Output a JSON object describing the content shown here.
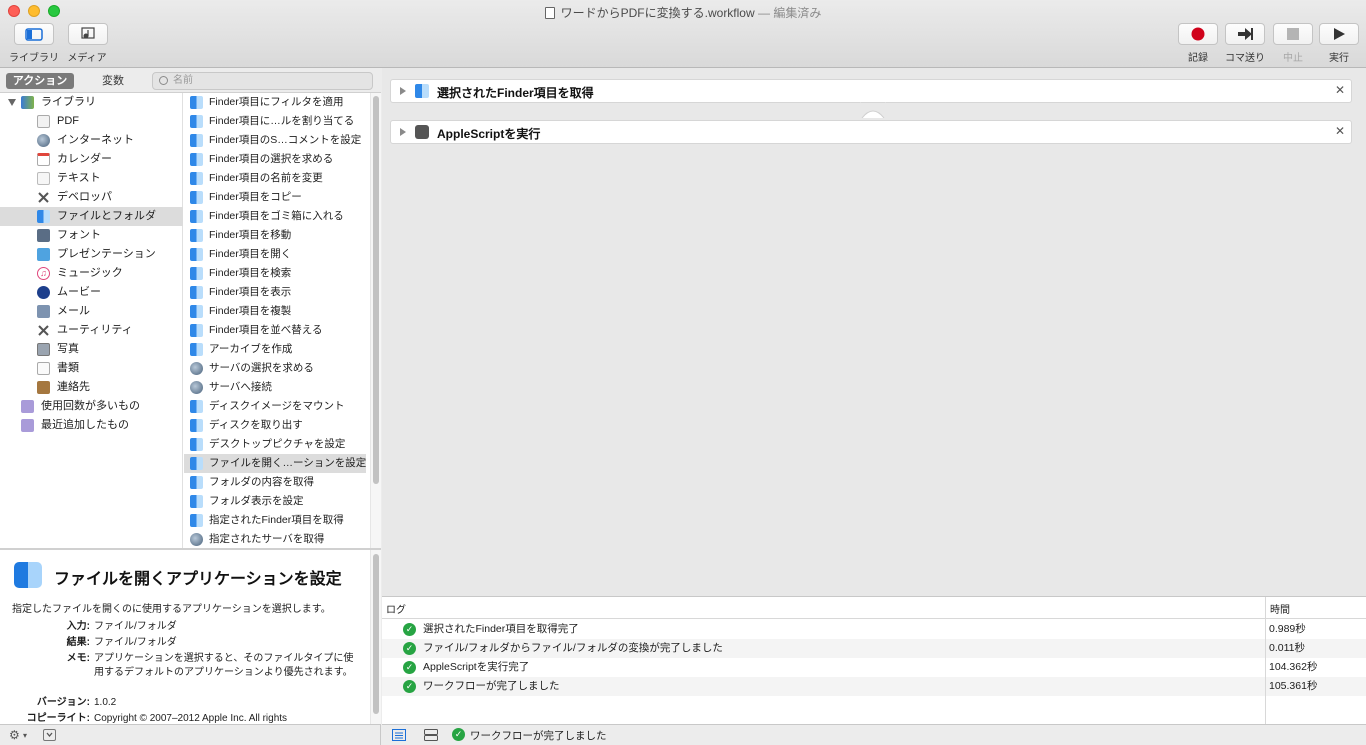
{
  "window": {
    "title": "ワードからPDFに変換する.workflow",
    "edited": "— 編集済み"
  },
  "toolbar": {
    "library_label": "ライブラリ",
    "media_label": "メディア",
    "record_label": "記録",
    "step_label": "コマ送り",
    "stop_label": "中止",
    "run_label": "実行",
    "record_color": "#d0021b"
  },
  "left_header": {
    "actions_tab": "アクション",
    "variables_tab": "変数",
    "search_placeholder": "名前"
  },
  "library": {
    "root": "ライブラリ",
    "items": [
      {
        "label": "PDF",
        "icon": "pdf-icon"
      },
      {
        "label": "インターネット",
        "icon": "globe-icon"
      },
      {
        "label": "カレンダー",
        "icon": "calendar-icon"
      },
      {
        "label": "テキスト",
        "icon": "text-icon"
      },
      {
        "label": "デベロッパ",
        "icon": "tools-icon"
      },
      {
        "label": "ファイルとフォルダ",
        "icon": "finder-icon"
      },
      {
        "label": "フォント",
        "icon": "font-icon"
      },
      {
        "label": "プレゼンテーション",
        "icon": "presentation-icon"
      },
      {
        "label": "ミュージック",
        "icon": "music-icon"
      },
      {
        "label": "ムービー",
        "icon": "movie-icon"
      },
      {
        "label": "メール",
        "icon": "mail-icon"
      },
      {
        "label": "ユーティリティ",
        "icon": "utility-icon"
      },
      {
        "label": "写真",
        "icon": "photo-icon"
      },
      {
        "label": "書類",
        "icon": "document-icon"
      },
      {
        "label": "連絡先",
        "icon": "contacts-icon"
      }
    ],
    "smart_groups": [
      "使用回数が多いもの",
      "最近追加したもの"
    ]
  },
  "actions": [
    {
      "label": "Finder項目にフィルタを適用",
      "icon": "finder"
    },
    {
      "label": "Finder項目に…ルを割り当てる",
      "icon": "finder"
    },
    {
      "label": "Finder項目のS…コメントを設定",
      "icon": "finder"
    },
    {
      "label": "Finder項目の選択を求める",
      "icon": "finder"
    },
    {
      "label": "Finder項目の名前を変更",
      "icon": "finder"
    },
    {
      "label": "Finder項目をコピー",
      "icon": "finder"
    },
    {
      "label": "Finder項目をゴミ箱に入れる",
      "icon": "finder"
    },
    {
      "label": "Finder項目を移動",
      "icon": "finder"
    },
    {
      "label": "Finder項目を開く",
      "icon": "finder"
    },
    {
      "label": "Finder項目を検索",
      "icon": "finder"
    },
    {
      "label": "Finder項目を表示",
      "icon": "finder"
    },
    {
      "label": "Finder項目を複製",
      "icon": "finder"
    },
    {
      "label": "Finder項目を並べ替える",
      "icon": "finder"
    },
    {
      "label": "アーカイブを作成",
      "icon": "finder"
    },
    {
      "label": "サーバの選択を求める",
      "icon": "globe"
    },
    {
      "label": "サーバへ接続",
      "icon": "globe"
    },
    {
      "label": "ディスクイメージをマウント",
      "icon": "finder"
    },
    {
      "label": "ディスクを取り出す",
      "icon": "finder"
    },
    {
      "label": "デスクトップピクチャを設定",
      "icon": "finder"
    },
    {
      "label": "ファイルを開く…ーションを設定",
      "icon": "finder"
    },
    {
      "label": "フォルダの内容を取得",
      "icon": "finder"
    },
    {
      "label": "フォルダ表示を設定",
      "icon": "finder"
    },
    {
      "label": "指定されたFinder項目を取得",
      "icon": "finder"
    },
    {
      "label": "指定されたサーバを取得",
      "icon": "globe"
    }
  ],
  "description": {
    "title": "ファイルを開くアプリケーションを設定",
    "summary": "指定したファイルを開くのに使用するアプリケーションを選択します。",
    "input_key": "入力:",
    "input_val": "ファイル/フォルダ",
    "result_key": "結果:",
    "result_val": "ファイル/フォルダ",
    "memo_key": "メモ:",
    "memo_val": "アプリケーションを選択すると、そのファイルタイプに使用するデフォルトのアプリケーションより優先されます。",
    "version_key": "バージョン:",
    "version_val": "1.0.2",
    "copyright_key": "コピーライト:",
    "copyright_val": "Copyright © 2007–2012 Apple Inc.  All rights"
  },
  "workflow": [
    {
      "title": "選択されたFinder項目を取得"
    },
    {
      "title": "AppleScriptを実行"
    }
  ],
  "log": {
    "col_log": "ログ",
    "col_time": "時間",
    "rows": [
      {
        "msg": "選択されたFinder項目を取得完了",
        "time": "0.989秒"
      },
      {
        "msg": "ファイル/フォルダからファイル/フォルダの変換が完了しました",
        "time": "0.011秒"
      },
      {
        "msg": "AppleScriptを実行完了",
        "time": "104.362秒"
      },
      {
        "msg": "ワークフローが完了しました",
        "time": "105.361秒"
      }
    ]
  },
  "status": {
    "text": "ワークフローが完了しました"
  }
}
